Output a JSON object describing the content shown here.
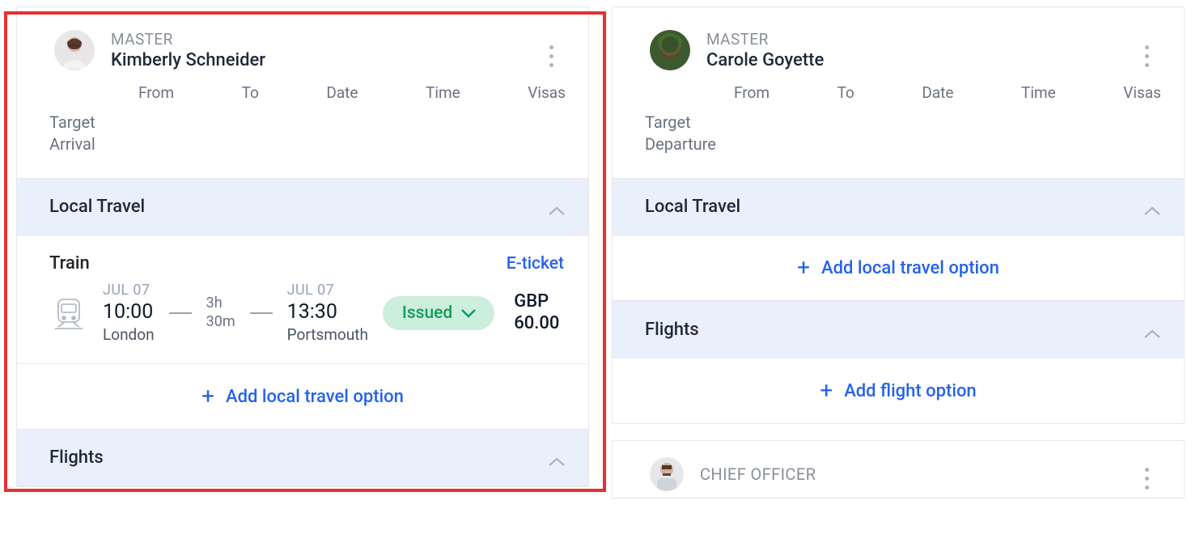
{
  "columns": [
    {
      "role": "MASTER",
      "name": "Kimberly Schneider",
      "header_labels": {
        "from": "From",
        "to": "To",
        "date": "Date",
        "time": "Time",
        "visas": "Visas"
      },
      "target_line1": "Target",
      "target_line2": "Arrival",
      "sections": {
        "local_travel": {
          "title": "Local Travel",
          "train": {
            "mode_label": "Train",
            "eticket_label": "E-ticket",
            "dep_date": "JUL 07",
            "dep_time": "10:00",
            "dep_city": "London",
            "duration_line1": "3h",
            "duration_line2": "30m",
            "arr_date": "JUL 07",
            "arr_time": "13:30",
            "arr_city": "Portsmouth",
            "status": "Issued",
            "currency": "GBP",
            "amount": "60.00"
          },
          "add_label": "Add local travel option"
        },
        "flights": {
          "title": "Flights"
        }
      }
    },
    {
      "role": "MASTER",
      "name": "Carole Goyette",
      "header_labels": {
        "from": "From",
        "to": "To",
        "date": "Date",
        "time": "Time",
        "visas": "Visas"
      },
      "target_line1": "Target",
      "target_line2": "Departure",
      "sections": {
        "local_travel": {
          "title": "Local Travel",
          "add_label": "Add local travel option"
        },
        "flights": {
          "title": "Flights",
          "add_label": "Add flight option"
        }
      },
      "next_card_role": "CHIEF OFFICER"
    }
  ]
}
